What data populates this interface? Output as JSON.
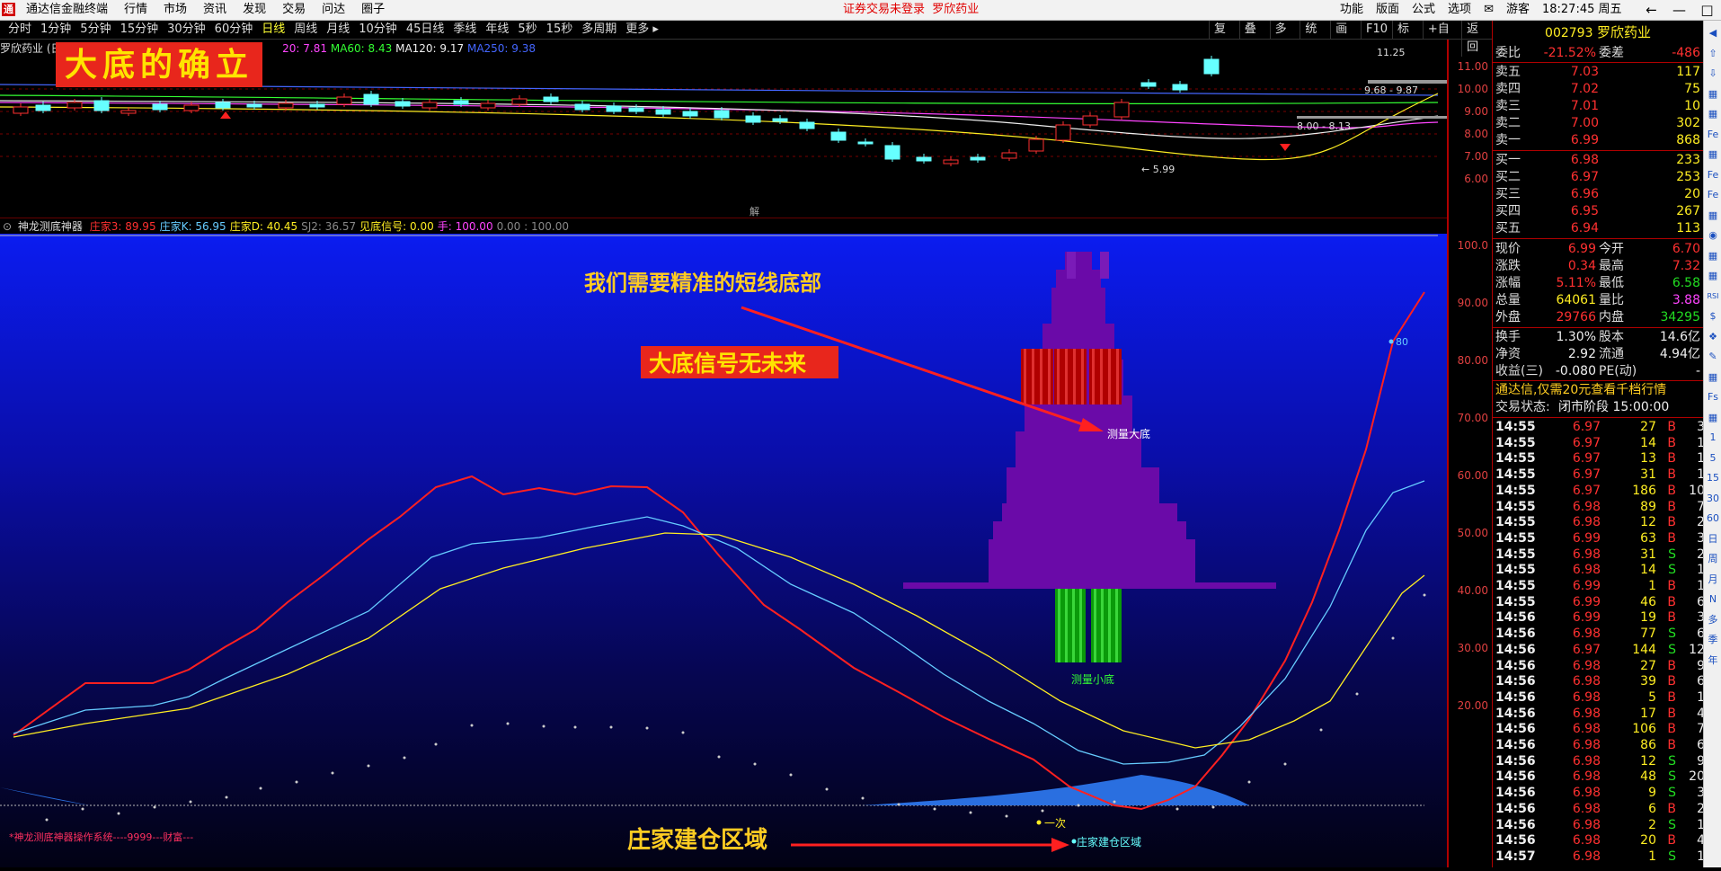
{
  "app": {
    "logo": "通",
    "title": "通达信金融终端",
    "menu": [
      "行情",
      "市场",
      "资讯",
      "发现",
      "交易",
      "问达",
      "圈子"
    ],
    "notice": "证券交易未登录  罗欣药业",
    "right_menu": [
      "功能",
      "版面",
      "公式",
      "选项",
      "✉",
      "游客",
      "18:27:45 周五"
    ],
    "win_buttons": [
      "←",
      "—",
      "□",
      "✕"
    ]
  },
  "toolbar": {
    "periods": [
      "分时",
      "1分钟",
      "5分钟",
      "15分钟",
      "30分钟",
      "60分钟",
      "日线",
      "周线",
      "月线",
      "10分钟",
      "45日线",
      "季线",
      "年线",
      "5秒",
      "15秒",
      "多周期",
      "更多 ▸"
    ],
    "active": "日线",
    "tools": [
      "复权",
      "叠加",
      "多股",
      "统计",
      "画线",
      "F10",
      "标记",
      "+自选",
      "返回"
    ]
  },
  "main_chart": {
    "stock_label": "罗欣药业 (日",
    "ma": [
      {
        "label": "20: 7.81",
        "color": "#ff44ff"
      },
      {
        "label": "MA60: 8.43",
        "color": "#33ff33"
      },
      {
        "label": "MA120: 9.17",
        "color": "#eeeeee"
      },
      {
        "label": "MA250: 9.38",
        "color": "#4466ff"
      }
    ],
    "banner": "大底的确立",
    "price_ticks": [
      "11.00",
      "10.00",
      "9.00",
      "8.00",
      "7.00",
      "6.00"
    ],
    "labels": {
      "high": "11.25",
      "l1": "9.68 - 9.87",
      "l2": "8.00 - 8.13",
      "low": "← 5.99"
    },
    "divider_icon": "解"
  },
  "indicator": {
    "name": "神龙测底神器",
    "fields": [
      {
        "label": "庄家3: 89.95",
        "color": "#ff3030"
      },
      {
        "label": "庄家K: 56.95",
        "color": "#66ccff"
      },
      {
        "label": "庄家D: 40.45",
        "color": "#ffee22"
      },
      {
        "label": "SJ2: 36.57",
        "color": "#888888"
      },
      {
        "label": "见底信号: 0.00",
        "color": "#ffee22"
      },
      {
        "label": "手: 100.00",
        "color": "#ff44ff"
      },
      {
        "label": "0.00 : 100.00",
        "color": "#888888"
      }
    ],
    "ticks": [
      "100.0",
      "90.00",
      "80.00",
      "70.00",
      "60.00",
      "50.00",
      "40.00",
      "30.00",
      "20.00"
    ],
    "ann_top": "我们需要精准的短线底部",
    "ann_box": "大底信号无未来",
    "label_big": "测量大底",
    "label_small": "测量小底",
    "label_once": "一次",
    "label_build": "庄家建仓区域",
    "ann_bottom": "庄家建仓区域",
    "footer": "*神龙测底神器操作系统----9999---财富---",
    "value_80": "80"
  },
  "panel": {
    "code": "002793",
    "name": "罗欣药业",
    "webi": {
      "label": "委比",
      "value": "-21.52%",
      "label2": "委差",
      "value2": "-486"
    },
    "asks": [
      {
        "label": "卖五",
        "price": "7.03",
        "vol": "117"
      },
      {
        "label": "卖四",
        "price": "7.02",
        "vol": "75"
      },
      {
        "label": "卖三",
        "price": "7.01",
        "vol": "10"
      },
      {
        "label": "卖二",
        "price": "7.00",
        "vol": "302"
      },
      {
        "label": "卖一",
        "price": "6.99",
        "vol": "868"
      }
    ],
    "bids": [
      {
        "label": "买一",
        "price": "6.98",
        "vol": "233"
      },
      {
        "label": "买二",
        "price": "6.97",
        "vol": "253"
      },
      {
        "label": "买三",
        "price": "6.96",
        "vol": "20"
      },
      {
        "label": "买四",
        "price": "6.95",
        "vol": "267"
      },
      {
        "label": "买五",
        "price": "6.94",
        "vol": "113"
      }
    ],
    "quote": [
      {
        "l": "现价",
        "v": "6.99",
        "c": "red",
        "l2": "今开",
        "v2": "6.70",
        "c2": "red"
      },
      {
        "l": "涨跌",
        "v": "0.34",
        "c": "red",
        "l2": "最高",
        "v2": "7.32",
        "c2": "red"
      },
      {
        "l": "涨幅",
        "v": "5.11%",
        "c": "red",
        "l2": "最低",
        "v2": "6.58",
        "c2": "green"
      },
      {
        "l": "总量",
        "v": "64061",
        "c": "yellow",
        "l2": "量比",
        "v2": "3.88",
        "c2": "mag"
      },
      {
        "l": "外盘",
        "v": "29766",
        "c": "red",
        "l2": "内盘",
        "v2": "34295",
        "c2": "green"
      }
    ],
    "stats": [
      {
        "l": "换手",
        "v": "1.30%",
        "l2": "股本",
        "v2": "14.6亿"
      },
      {
        "l": "净资",
        "v": "2.92",
        "l2": "流通",
        "v2": "4.94亿"
      },
      {
        "l": "收益(三)",
        "v": "-0.080",
        "l2": "PE(动)",
        "v2": "-"
      }
    ],
    "promo": "通达信,仅需20元查看千档行情",
    "status_label": "交易状态:",
    "status_value": "闭市阶段 15:00:00",
    "ticks": [
      [
        "14:55",
        "6.97",
        "27",
        "B",
        "3"
      ],
      [
        "14:55",
        "6.97",
        "14",
        "B",
        "1"
      ],
      [
        "14:55",
        "6.97",
        "13",
        "B",
        "1"
      ],
      [
        "14:55",
        "6.97",
        "31",
        "B",
        "1"
      ],
      [
        "14:55",
        "6.97",
        "186",
        "B",
        "10"
      ],
      [
        "14:55",
        "6.98",
        "89",
        "B",
        "7"
      ],
      [
        "14:55",
        "6.98",
        "12",
        "B",
        "2"
      ],
      [
        "14:55",
        "6.99",
        "63",
        "B",
        "3"
      ],
      [
        "14:55",
        "6.98",
        "31",
        "S",
        "2"
      ],
      [
        "14:55",
        "6.98",
        "14",
        "S",
        "1"
      ],
      [
        "14:55",
        "6.99",
        "1",
        "B",
        "1"
      ],
      [
        "14:55",
        "6.99",
        "46",
        "B",
        "6"
      ],
      [
        "14:56",
        "6.99",
        "19",
        "B",
        "3"
      ],
      [
        "14:56",
        "6.98",
        "77",
        "S",
        "6"
      ],
      [
        "14:56",
        "6.97",
        "144",
        "S",
        "12"
      ],
      [
        "14:56",
        "6.98",
        "27",
        "B",
        "9"
      ],
      [
        "14:56",
        "6.98",
        "39",
        "B",
        "6"
      ],
      [
        "14:56",
        "6.98",
        "5",
        "B",
        "1"
      ],
      [
        "14:56",
        "6.98",
        "17",
        "B",
        "4"
      ],
      [
        "14:56",
        "6.98",
        "106",
        "B",
        "7"
      ],
      [
        "14:56",
        "6.98",
        "86",
        "B",
        "6"
      ],
      [
        "14:56",
        "6.98",
        "12",
        "S",
        "9"
      ],
      [
        "14:56",
        "6.98",
        "48",
        "S",
        "20"
      ],
      [
        "14:56",
        "6.98",
        "9",
        "S",
        "3"
      ],
      [
        "14:56",
        "6.98",
        "6",
        "B",
        "2"
      ],
      [
        "14:56",
        "6.98",
        "2",
        "S",
        "1"
      ],
      [
        "14:56",
        "6.98",
        "20",
        "B",
        "4"
      ],
      [
        "14:57",
        "6.98",
        "1",
        "S",
        "1"
      ]
    ]
  },
  "vtool": [
    "◀",
    "⇧",
    "⇩",
    "▦",
    "▦",
    "Fe",
    "▦",
    "Fe",
    "Fe",
    "▦",
    "◉",
    "▦",
    "▦",
    "RSI",
    "$",
    "❖",
    "✎",
    "▦",
    "Fs",
    "▦",
    "1",
    "5",
    "15",
    "30",
    "60",
    "日",
    "周",
    "月",
    "N",
    "多",
    "季",
    "年"
  ]
}
